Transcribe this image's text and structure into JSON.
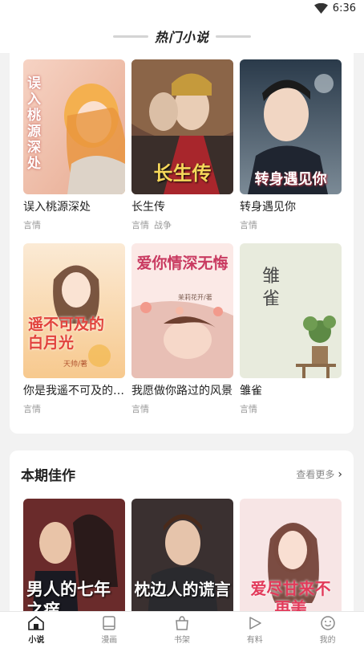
{
  "status_bar": {
    "time": "6:36"
  },
  "header": {
    "title": "热门小说"
  },
  "hot_novels": [
    {
      "title": "误入桃源深处",
      "tags": [
        "言情"
      ],
      "cover_text": "误入桃源深处"
    },
    {
      "title": "长生传",
      "tags": [
        "言情",
        "战争"
      ],
      "cover_text": "长生传"
    },
    {
      "title": "转身遇见你",
      "tags": [
        "言情"
      ],
      "cover_text": "转身遇见你"
    },
    {
      "title": "你是我遥不可及的白月光",
      "tags": [
        "言情"
      ],
      "cover_text": "遥不可及的白月光",
      "cover_author": "天帅/著"
    },
    {
      "title": "我愿做你路过的风景",
      "tags": [
        "言情"
      ],
      "cover_text": "爱你情深无悔",
      "cover_author": "茉莉花开/著"
    },
    {
      "title": "雏雀",
      "tags": [
        "言情"
      ],
      "cover_text": "雏雀"
    }
  ],
  "featured": {
    "title": "本期佳作",
    "see_more": "查看更多",
    "covers": [
      {
        "cover_text": "男人的七年之痒"
      },
      {
        "cover_text": "枕边人的谎言"
      },
      {
        "cover_text": "爱尽甘来不再美"
      }
    ]
  },
  "tabbar": {
    "tabs": [
      {
        "label": "小说",
        "icon": "home-icon",
        "active": true
      },
      {
        "label": "漫画",
        "icon": "book-icon",
        "active": false
      },
      {
        "label": "书架",
        "icon": "bag-icon",
        "active": false
      },
      {
        "label": "有料",
        "icon": "play-icon",
        "active": false
      },
      {
        "label": "我的",
        "icon": "smile-icon",
        "active": false
      }
    ]
  },
  "colors": {
    "accent": "#222222",
    "tag": "#999999"
  }
}
